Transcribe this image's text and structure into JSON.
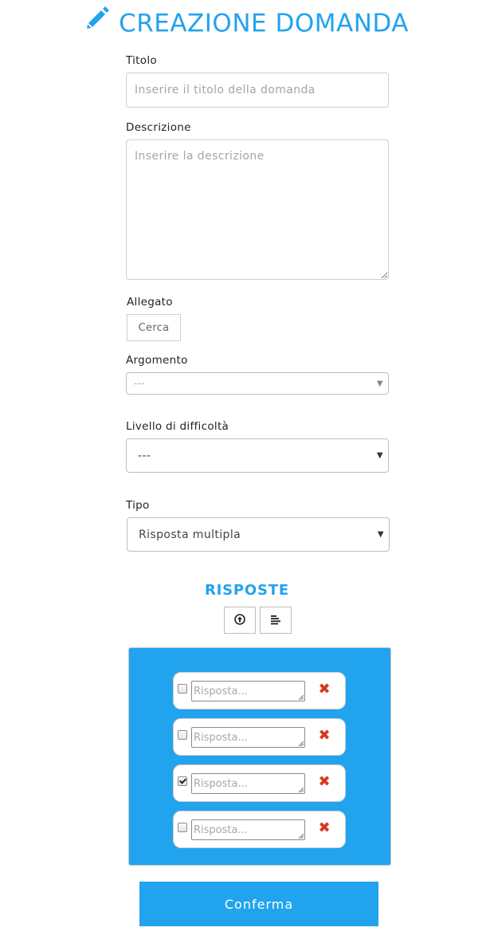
{
  "header": {
    "title": "CREAZIONE DOMANDA",
    "icon": "pencil-icon"
  },
  "form": {
    "titolo": {
      "label": "Titolo",
      "placeholder": "Inserire il titolo della domanda",
      "value": ""
    },
    "descrizione": {
      "label": "Descrizione",
      "placeholder": "Inserire la descrizione",
      "value": ""
    },
    "allegato": {
      "label": "Allegato",
      "button_label": "Cerca"
    },
    "argomento": {
      "label": "Argomento",
      "selected": "---"
    },
    "livello": {
      "label": "Livello di difficoltà",
      "selected": "---"
    },
    "tipo": {
      "label": "Tipo",
      "selected": "Risposta multipla"
    }
  },
  "answers": {
    "title": "RISPOSTE",
    "tools": [
      {
        "icon": "upload-circle-icon"
      },
      {
        "icon": "align-left-icon"
      }
    ],
    "items": [
      {
        "placeholder": "Risposta...",
        "checked": false,
        "remove_label": "✖"
      },
      {
        "placeholder": "Risposta...",
        "checked": false,
        "remove_label": "✖"
      },
      {
        "placeholder": "Risposta...",
        "checked": true,
        "remove_label": "✖"
      },
      {
        "placeholder": "Risposta...",
        "checked": false,
        "remove_label": "✖"
      }
    ],
    "panel_color": "#22a3ee",
    "remove_color": "#d6391c"
  },
  "confirm": {
    "label": "Conferma"
  },
  "colors": {
    "accent": "#22a3ee"
  }
}
